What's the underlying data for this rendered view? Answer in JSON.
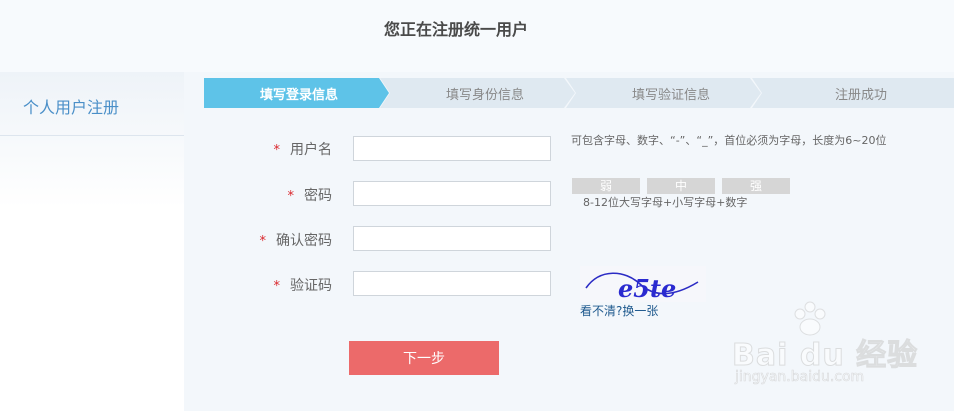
{
  "header": {
    "title": "您正在注册统一用户"
  },
  "sidebar": {
    "items": [
      {
        "label": "个人用户注册"
      }
    ]
  },
  "steps": [
    {
      "label": "填写登录信息",
      "active": true
    },
    {
      "label": "填写身份信息",
      "active": false
    },
    {
      "label": "填写验证信息",
      "active": false
    },
    {
      "label": "注册成功",
      "active": false
    }
  ],
  "form": {
    "required_mark": "*",
    "username": {
      "label": "用户名",
      "value": "",
      "hint": "可包含字母、数字、“-”、“_”，首位必须为字母，长度为6~20位"
    },
    "password": {
      "label": "密码",
      "value": "",
      "strength": [
        "弱",
        "中",
        "强"
      ],
      "hint": "8-12位大写字母+小写字母+数字"
    },
    "confirm_password": {
      "label": "确认密码",
      "value": ""
    },
    "captcha": {
      "label": "验证码",
      "value": "",
      "image_text": "e5te",
      "refresh_link": "看不清?换一张"
    },
    "next_button": "下一步"
  },
  "watermark": {
    "logo": "Bai du 经验",
    "url": "jingyan.baidu.com"
  },
  "colors": {
    "accent": "#5ec3e8",
    "step_inactive": "#dfe9f1",
    "button": "#ec6a6a",
    "required": "#d9242a",
    "link": "#1f5a8e"
  }
}
